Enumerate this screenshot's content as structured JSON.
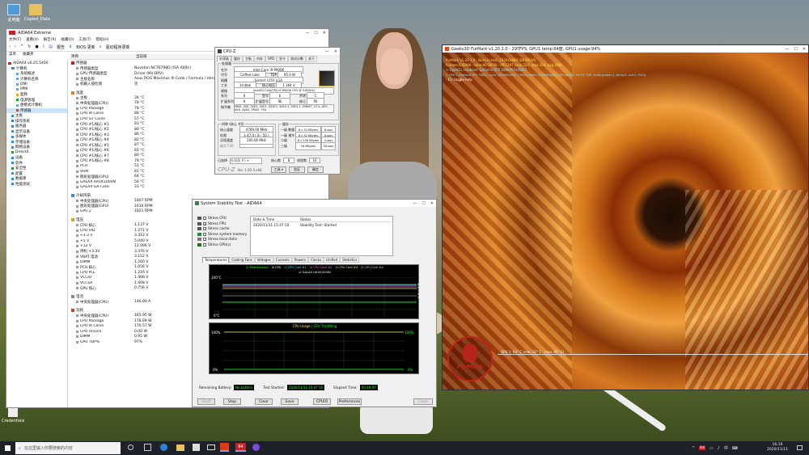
{
  "desktop": {
    "icons": [
      {
        "label": "此电脑"
      },
      {
        "label": "Copied_Data"
      },
      {
        "label": "Credentials"
      }
    ]
  },
  "aida": {
    "title": "AIDA64 Extreme",
    "menu": [
      "文件(F)",
      "查看(V)",
      "报告(R)",
      "收藏(O)",
      "工具(T)",
      "帮助(H)"
    ],
    "toolbar": {
      "report": "报告",
      "bios": "BIOS 更新",
      "driver": "驱动程序更新"
    },
    "tabs": {
      "menu": "菜单",
      "fav": "收藏夹"
    },
    "tree": [
      {
        "t": "AIDA64 v6.25.5400",
        "lvl": 0
      },
      {
        "t": "计算机",
        "lvl": 1
      },
      {
        "t": "系统概述",
        "lvl": 2
      },
      {
        "t": "计算机名称",
        "lvl": 2
      },
      {
        "t": "DMI",
        "lvl": 2
      },
      {
        "t": "IPMI",
        "lvl": 2
      },
      {
        "t": "超频",
        "lvl": 2
      },
      {
        "t": "电源管理",
        "lvl": 2
      },
      {
        "t": "便携式计算机",
        "lvl": 2
      },
      {
        "t": "传感器",
        "lvl": 2,
        "sel": true
      },
      {
        "t": "主板",
        "lvl": 1
      },
      {
        "t": "操作系统",
        "lvl": 1
      },
      {
        "t": "服务器",
        "lvl": 1
      },
      {
        "t": "显示设备",
        "lvl": 1
      },
      {
        "t": "多媒体",
        "lvl": 1
      },
      {
        "t": "存储设备",
        "lvl": 1
      },
      {
        "t": "网络设备",
        "lvl": 1
      },
      {
        "t": "DirectX",
        "lvl": 1
      },
      {
        "t": "设备",
        "lvl": 1
      },
      {
        "t": "软件",
        "lvl": 1
      },
      {
        "t": "安全性",
        "lvl": 1
      },
      {
        "t": "配置",
        "lvl": 1
      },
      {
        "t": "数据库",
        "lvl": 1
      },
      {
        "t": "性能测试",
        "lvl": 1
      }
    ],
    "col_item": "项目",
    "col_val": "当前值",
    "sections": [
      {
        "h": "传感器",
        "rows": [
          [
            "传感器类型",
            "Nuvoton NCT6798D (ISA A00h)"
          ],
          [
            "GPU 传感器类型",
            "Driver (NV-DRV)"
          ],
          [
            "主板名称",
            "Asus ROG Maximus XI Code / Formula / Hero"
          ],
          [
            "机箱入侵检测",
            "否"
          ]
        ]
      },
      {
        "h": "温度",
        "rows": [
          [
            "主板",
            "39 °C"
          ],
          [
            "中央处理器(CPU)",
            "78 °C"
          ],
          [
            "CPU Package",
            "78 °C"
          ],
          [
            "CPU IA Cores",
            "88 °C"
          ],
          [
            "CPU GT Cores",
            "57 °C"
          ],
          [
            "CPU #1/核心 #1",
            "83 °C"
          ],
          [
            "CPU #1/核心 #2",
            "80 °C"
          ],
          [
            "CPU #1/核心 #3",
            "86 °C"
          ],
          [
            "CPU #1/核心 #4",
            "82 °C"
          ],
          [
            "CPU #1/核心 #5",
            "87 °C"
          ],
          [
            "CPU #1/核心 #6",
            "81 °C"
          ],
          [
            "CPU #1/核心 #7",
            "80 °C"
          ],
          [
            "CPU #1/核心 #8",
            "79 °C"
          ],
          [
            "PCH",
            "51 °C"
          ],
          [
            "VRM",
            "81 °C"
          ],
          [
            "图形处理器(GPU)",
            "64 °C"
          ],
          [
            "GALAX HA1K1000N",
            "56 °C"
          ],
          [
            "GALAX GA-T240",
            "33 °C"
          ]
        ]
      },
      {
        "h": "冷却风扇",
        "rows": [
          [
            "中央处理器(CPU)",
            "1807 RPM"
          ],
          [
            "图形处理器(GPU)",
            "1610 RPM"
          ],
          [
            "GPU 2",
            "1821 RPM"
          ]
        ]
      },
      {
        "h": "电压",
        "rows": [
          [
            "CPU 核心",
            "1.137 V"
          ],
          [
            "CPU VID",
            "1.271 V"
          ],
          [
            "+3.3 V",
            "3.312 V"
          ],
          [
            "+5 V",
            "5.040 V"
          ],
          [
            "+12 V",
            "12.096 V"
          ],
          [
            "待机 +3.3V",
            "3.376 V"
          ],
          [
            "VBAT 电池",
            "3.152 V"
          ],
          [
            "DIMM",
            "1.200 V"
          ],
          [
            "PCH 核心",
            "1.056 V"
          ],
          [
            "CPU PLL",
            "1.216 V"
          ],
          [
            "VCCIO",
            "1.408 V"
          ],
          [
            "VCCSA",
            "1.408 V"
          ],
          [
            "GPU 核心",
            "0.756 V"
          ]
        ]
      },
      {
        "h": "电流",
        "rows": [
          [
            "中央处理器(CPU)",
            "146.00 A"
          ]
        ]
      },
      {
        "h": "功耗",
        "rows": [
          [
            "中央处理器(CPU)",
            "165.95 W"
          ],
          [
            "CPU Package",
            "178.69 W"
          ],
          [
            "CPU IA Cores",
            "170.57 W"
          ],
          [
            "CPU Uncore",
            "0.00 W"
          ],
          [
            "DIMM",
            "0.95 W"
          ],
          [
            "GPU TDP%",
            "97%"
          ]
        ]
      }
    ]
  },
  "cpuz": {
    "title": "CPU-Z",
    "tabs": [
      "处理器",
      "缓存",
      "主板",
      "内存",
      "SPD",
      "显卡",
      "测试分数",
      "关于"
    ],
    "group_proc": "处理器",
    "fields": [
      [
        "名字",
        "Intel Core i9 9900K"
      ],
      [
        "代号",
        "Coffee Lake",
        "TDP",
        "95.0 W"
      ],
      [
        "插槽",
        "Socket 1151 LGA"
      ],
      [
        "工艺",
        "14 纳米",
        "核心电压",
        "1.164 V"
      ],
      [
        "规格",
        "Intel(R) Core(TM) i9-9900K CPU @ 3.60GHz"
      ],
      [
        "系列",
        "6",
        "型号",
        "E",
        "步进",
        "C"
      ],
      [
        "扩展系列",
        "6",
        "扩展型号",
        "9E",
        "修订",
        "P0"
      ],
      [
        "指令集",
        "MMX, SSE, SSE2, SSE3, SSSE3, SSE4.1, SSE4.2, EM64T, VT-x, AES, AVX, AVX2, FMA3, TSX"
      ]
    ],
    "clocks_title": "时钟 (核心 #0)",
    "clocks": [
      [
        "核心速度",
        "4789.00 MHz"
      ],
      [
        "倍频",
        "x 47.0 ( 8 - 50 )"
      ],
      [
        "总线速度",
        "100.00 MHz"
      ],
      [
        "额定 FSB",
        ""
      ]
    ],
    "cache_title": "缓存",
    "cache": [
      [
        "一级 数据",
        "8 x 32 KBytes",
        "8-way"
      ],
      [
        "一级 指令",
        "8 x 32 KBytes",
        "8-way"
      ],
      [
        "二级",
        "8 x 256 KBytes",
        "4-way"
      ],
      [
        "三级",
        "16 MBytes",
        "16-way"
      ]
    ],
    "selected_label": "已选择",
    "selected": "处理器 #1",
    "cores_label": "核心数",
    "cores": "8",
    "threads_label": "线程数",
    "threads": "16",
    "brand": "CPU-Z",
    "version": "Ver. 1.92.0.x64",
    "tools": "工具",
    "validate": "验证",
    "ok": "确定"
  },
  "sst": {
    "title": "System Stability Test - AIDA64",
    "checks": [
      {
        "t": "Stress CPU",
        "on": false
      },
      {
        "t": "Stress FPU",
        "on": true
      },
      {
        "t": "Stress cache",
        "on": false
      },
      {
        "t": "Stress system memory",
        "on": false
      },
      {
        "t": "Stress local disks",
        "on": false
      },
      {
        "t": "Stress GPU(s)",
        "on": false
      }
    ],
    "log_hdr_dt": "Date & Time",
    "log_hdr_st": "Status",
    "log_dt": "2020/11/11 15:47:10",
    "log_st": "Stability Test: Started",
    "tabs": [
      "Temperatures",
      "Cooling Fans",
      "Voltages",
      "Currents",
      "Powers",
      "Clocks",
      "Unified",
      "Statistics"
    ],
    "legend": [
      {
        "t": "Motherboard",
        "c": "#2aff2a"
      },
      {
        "t": "CPU",
        "c": "#ffffff"
      },
      {
        "t": "CPU Core #1",
        "c": "#48d8ff"
      },
      {
        "t": "CPU Core #2",
        "c": "#ff6dff"
      },
      {
        "t": "CPU Core #3",
        "c": "#ffe066"
      },
      {
        "t": "CPU Core #4",
        "c": "#c8c8c8"
      }
    ],
    "legend2": "GALAX HA1K1000N",
    "temp_top": "100°C",
    "temp_bot": "0°C",
    "temp_right": [
      "88",
      "81",
      "79",
      "56",
      "39"
    ],
    "usage_title": "CPU Usage",
    "throttle_title": "CPU Throttling",
    "usage_top_l": "100%",
    "usage_bot_l": "0%",
    "usage_top_r": "100%",
    "usage_bot_r": "0%",
    "remaining_label": "Remaining Battery:",
    "remaining": "No battery",
    "started_label": "Test Started:",
    "started": "2020/11/11 15:47:10",
    "elapsed_label": "Elapsed Time:",
    "elapsed": "00:29:59",
    "buttons": [
      "Start",
      "Stop",
      "Clear",
      "Save",
      "CPUID",
      "Preferences",
      "Close"
    ]
  },
  "furmark": {
    "title": "Geeks3D FurMark v1.20.1.0 - 297FPS, GPU1 temp:64度, GPU1 usage:94%",
    "lines": [
      {
        "t": "FurMark v1.20.1.0 - Burn-in test, 1920x1080 (0X MSAA)",
        "c": "#ffe34a"
      },
      {
        "t": "Frames:536086 - time:00:30:00 - FPS:297 (min:224, max:310, avg:298)",
        "c": "#ffe34a"
      },
      {
        "t": "> OpenGL renderer: GeForce RTX 3080/PCIe/SSE2",
        "c": "#7ee8ff"
      },
      {
        "t": "> GPU 1 (GeForce RTX 3080) - core: 1815MHz/64° C/94%, mem: 9751MHz/6%, GPU power: 94.1% TDP, limits:[power:1, temp:0, volt:0, OV:0]",
        "c": "#7ee8ff"
      },
      {
        "t": "- F1: toggle help",
        "c": "#ffffff"
      }
    ],
    "graph_label": "GPU 1: 64° C (min: 32° C - max: 65° C)",
    "logo": "FurMark"
  },
  "taskbar": {
    "search": "在这里输入你要搜索的内容",
    "time": "16:16",
    "date": "2020/11/11",
    "tray_num": "64",
    "ime": "中",
    "app_badge": "64"
  }
}
